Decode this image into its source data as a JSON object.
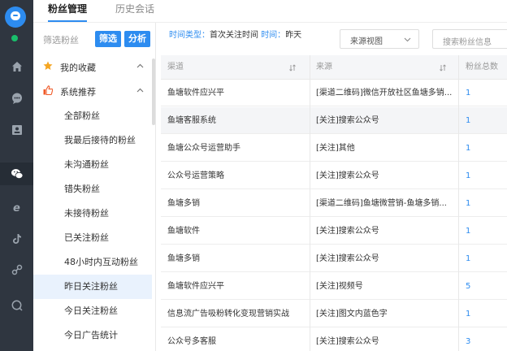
{
  "tabs": {
    "fans": "粉丝管理",
    "history": "历史会话"
  },
  "sidebar": {
    "filter_label": "筛选粉丝",
    "filter_button": "筛选",
    "analyze_button": "分析",
    "group_favorites": "我的收藏",
    "group_recommend": "系统推荐",
    "items": [
      {
        "label": "全部粉丝"
      },
      {
        "label": "我最后接待的粉丝"
      },
      {
        "label": "未沟通粉丝"
      },
      {
        "label": "错失粉丝"
      },
      {
        "label": "未接待粉丝"
      },
      {
        "label": "已关注粉丝"
      },
      {
        "label": "48小时内互动粉丝"
      },
      {
        "label": "昨日关注粉丝"
      },
      {
        "label": "今日关注粉丝"
      },
      {
        "label": "今日广告统计"
      }
    ],
    "active_index": 7
  },
  "main": {
    "time_type_key": "时间类型：",
    "time_type_value": "首次关注时间",
    "time_key": "时间：",
    "time_value": "昨天",
    "view_select": "来源视图",
    "search_placeholder": "搜索粉丝信息"
  },
  "table": {
    "columns": [
      "渠道",
      "来源",
      "粉丝总数"
    ],
    "rows": [
      {
        "channel": "鱼塘软件应兴平",
        "source": "[渠道二维码]微信开放社区鱼塘多销...",
        "count": "1"
      },
      {
        "channel": "鱼塘客服系统",
        "source": "[关注]搜索公众号",
        "count": "1"
      },
      {
        "channel": "鱼塘公众号运营助手",
        "source": "[关注]其他",
        "count": "1"
      },
      {
        "channel": "公众号运营策略",
        "source": "[关注]搜索公众号",
        "count": "1"
      },
      {
        "channel": "鱼塘多销",
        "source": "[渠道二维码]鱼塘微营销-鱼塘多销...",
        "count": "1"
      },
      {
        "channel": "鱼塘软件",
        "source": "[关注]搜索公众号",
        "count": "1"
      },
      {
        "channel": "鱼塘多销",
        "source": "[关注]搜索公众号",
        "count": "1"
      },
      {
        "channel": "鱼塘软件应兴平",
        "source": "[关注]视频号",
        "count": "5"
      },
      {
        "channel": "信息流广告吸粉转化变现营销实战",
        "source": "[关注]图文内蓝色字",
        "count": "1"
      },
      {
        "channel": "公众号多客服",
        "source": "[关注]搜索公众号",
        "count": "3"
      }
    ],
    "highlight_row": 1
  },
  "colors": {
    "accent": "#2d8cf0",
    "rail": "#2f3640",
    "online": "#19be6b",
    "favorite": "#f5a623",
    "recommend": "#f05a28"
  }
}
